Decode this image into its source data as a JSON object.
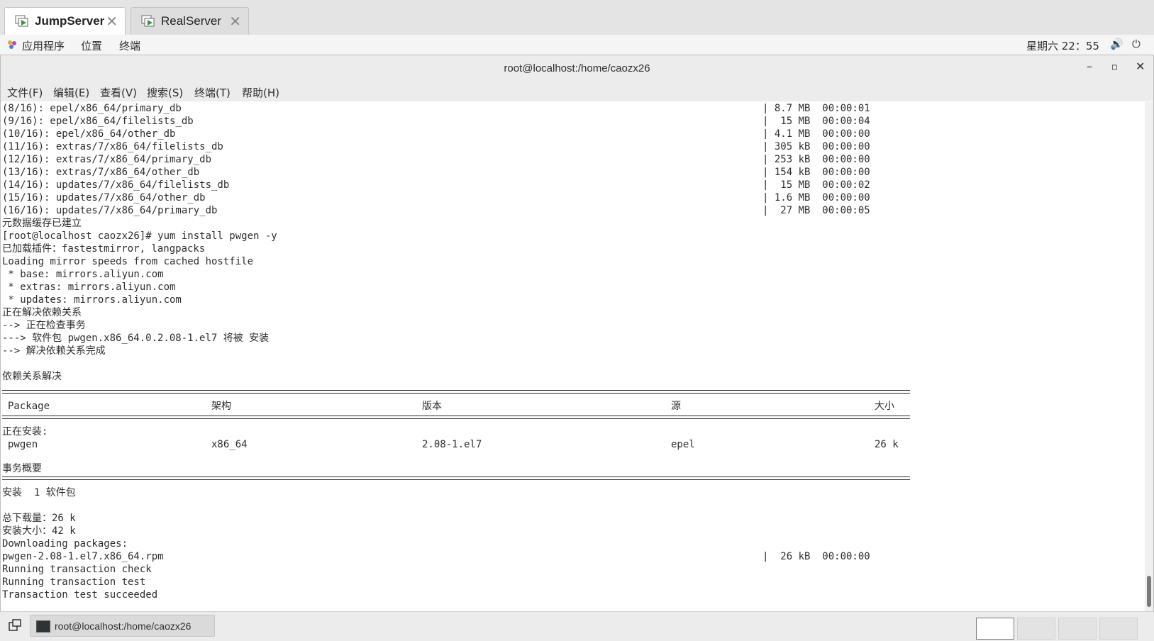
{
  "vm_tabs": [
    {
      "label": "JumpServer",
      "active": true
    },
    {
      "label": "RealServer",
      "active": false
    }
  ],
  "topbar": {
    "menus": [
      "应用程序",
      "位置",
      "终端"
    ],
    "clock": "星期六 22：55"
  },
  "window": {
    "title": "root@localhost:/home/caozx26",
    "menu": [
      "文件(F)",
      "编辑(E)",
      "查看(V)",
      "搜索(S)",
      "终端(T)",
      "帮助(H)"
    ]
  },
  "terminal": {
    "lines": [
      "(8/16): epel/x86_64/primary_db",
      "(9/16): epel/x86_64/filelists_db",
      "(10/16): epel/x86_64/other_db",
      "(11/16): extras/7/x86_64/filelists_db",
      "(12/16): extras/7/x86_64/primary_db",
      "(13/16): extras/7/x86_64/other_db",
      "(14/16): updates/7/x86_64/filelists_db",
      "(15/16): updates/7/x86_64/other_db",
      "(16/16): updates/7/x86_64/primary_db",
      "元数据缓存已建立",
      "[root@localhost caozx26]# yum install pwgen -y",
      "已加载插件：fastestmirror, langpacks",
      "Loading mirror speeds from cached hostfile",
      " * base: mirrors.aliyun.com",
      " * extras: mirrors.aliyun.com",
      " * updates: mirrors.aliyun.com",
      "正在解决依赖关系",
      "--> 正在检查事务",
      "---> 软件包 pwgen.x86_64.0.2.08-1.el7 将被 安装",
      "--> 解决依赖关系完成",
      "",
      "依赖关系解决"
    ],
    "download_stats": [
      "| 8.7 MB  00:00:01",
      "|  15 MB  00:00:04",
      "| 4.1 MB  00:00:00",
      "| 305 kB  00:00:00",
      "| 253 kB  00:00:00",
      "| 154 kB  00:00:00",
      "|  15 MB  00:00:02",
      "| 1.6 MB  00:00:00",
      "|  27 MB  00:00:05"
    ],
    "table_headers": [
      "Package",
      "架构",
      "版本",
      "源",
      "大小"
    ],
    "installing_label": "正在安装:",
    "package_row": [
      "pwgen",
      "x86_64",
      "2.08-1.el7",
      "epel",
      "26 k"
    ],
    "summary_label": "事务概要",
    "install_line": "安装  1 软件包",
    "tail_lines": [
      "",
      "总下载量：26 k",
      "安装大小：42 k",
      "Downloading packages:",
      "pwgen-2.08-1.el7.x86_64.rpm",
      "Running transaction check",
      "Running transaction test",
      "Transaction test succeeded"
    ],
    "rpm_download_stat": "|  26 kB  00:00:00"
  },
  "taskbar": {
    "task_label": "root@localhost:/home/caozx26",
    "workspaces": 4
  }
}
